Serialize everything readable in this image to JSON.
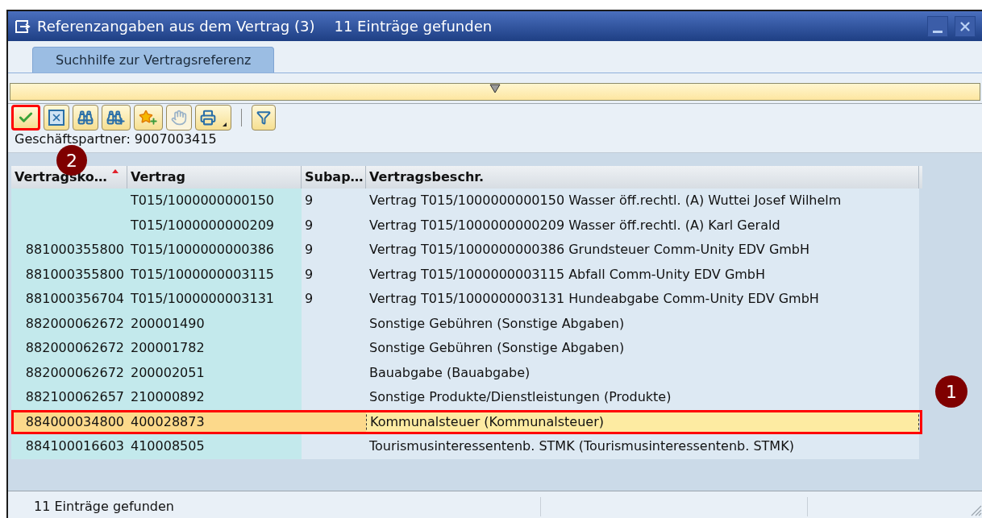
{
  "window": {
    "title": "Referenzangaben aus dem Vertrag (3)",
    "subtitle": "11 Einträge gefunden"
  },
  "tabs": [
    {
      "label": "Suchhilfe zur Vertragsreferenz",
      "selected": true
    }
  ],
  "toolbar": [
    {
      "kind": "check",
      "disabled": false,
      "highlighted": true
    },
    {
      "kind": "cancel",
      "disabled": false,
      "highlighted": false
    },
    {
      "kind": "find",
      "disabled": false,
      "highlighted": false
    },
    {
      "kind": "find-next",
      "disabled": false,
      "highlighted": false
    },
    {
      "kind": "favorite",
      "disabled": false,
      "highlighted": false
    },
    {
      "kind": "help",
      "disabled": true,
      "highlighted": false
    },
    {
      "kind": "print",
      "disabled": false,
      "highlighted": false
    },
    {
      "kind": "filter",
      "disabled": false,
      "highlighted": false
    }
  ],
  "partner": "Geschäftspartner: 9007003415",
  "table": {
    "columns": [
      "Vertragsko…",
      "Vertrag",
      "Subap…",
      "Vertragsbeschr."
    ],
    "rows": [
      {
        "cells": [
          "",
          "T015/1000000000150",
          "9",
          "Vertrag T015/1000000000150 Wasser öff.rechtl. (A) Wuttei Josef Wilhelm"
        ],
        "selected": false,
        "highlighted": false
      },
      {
        "cells": [
          "",
          "T015/1000000000209",
          "9",
          "Vertrag T015/1000000000209 Wasser öff.rechtl. (A) Karl Gerald"
        ],
        "selected": false,
        "highlighted": false
      },
      {
        "cells": [
          "881000355800",
          "T015/1000000000386",
          "9",
          "Vertrag T015/1000000000386 Grundsteuer Comm-Unity EDV GmbH"
        ],
        "selected": false,
        "highlighted": false
      },
      {
        "cells": [
          "881000355800",
          "T015/1000000003115",
          "9",
          "Vertrag T015/1000000003115 Abfall Comm-Unity EDV GmbH"
        ],
        "selected": false,
        "highlighted": false
      },
      {
        "cells": [
          "881000356704",
          "T015/1000000003131",
          "9",
          "Vertrag T015/1000000003131 Hundeabgabe Comm-Unity EDV GmbH"
        ],
        "selected": false,
        "highlighted": false
      },
      {
        "cells": [
          "882000062672",
          "200001490",
          "",
          "Sonstige Gebühren (Sonstige Abgaben)"
        ],
        "selected": false,
        "highlighted": false
      },
      {
        "cells": [
          "882000062672",
          "200001782",
          "",
          "Sonstige Gebühren (Sonstige Abgaben)"
        ],
        "selected": false,
        "highlighted": false
      },
      {
        "cells": [
          "882000062672",
          "200002051",
          "",
          "Bauabgabe (Bauabgabe)"
        ],
        "selected": false,
        "highlighted": false
      },
      {
        "cells": [
          "882100062657",
          "210000892",
          "",
          "Sonstige Produkte/Dienstleistungen (Produkte)"
        ],
        "selected": false,
        "highlighted": false
      },
      {
        "cells": [
          "884000034800",
          "400028873",
          "",
          "Kommunalsteuer (Kommunalsteuer)"
        ],
        "selected": true,
        "highlighted": true
      },
      {
        "cells": [
          "884100016603",
          "410008505",
          "",
          "Tourismusinteressentenb. STMK (Tourismusinteressentenb. STMK)"
        ],
        "selected": false,
        "highlighted": false
      }
    ]
  },
  "callouts": [
    {
      "number": "2"
    },
    {
      "number": "1"
    }
  ],
  "status_bar": {
    "text": "11 Einträge gefunden"
  }
}
